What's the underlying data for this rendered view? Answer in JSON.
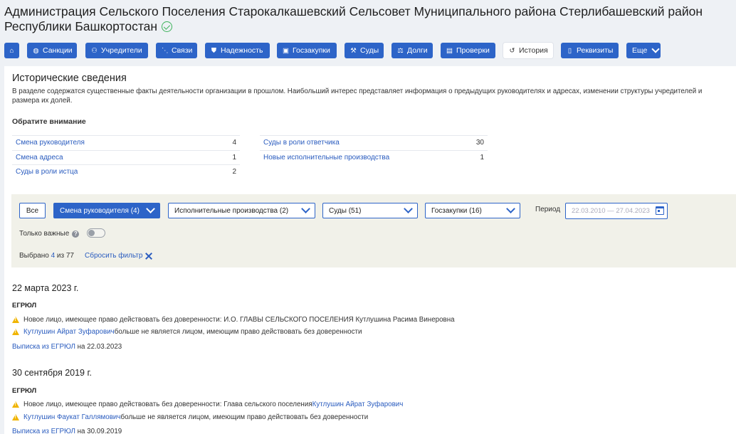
{
  "org": {
    "title": "Администрация Сельского Поселения Старокалкашевский Сельсовет Муниципального района Стерлибашевский район Республики Башкортостан"
  },
  "nav": {
    "items": [
      {
        "label": "",
        "icon": "home-icon"
      },
      {
        "label": "Санкции",
        "icon": "globe-icon"
      },
      {
        "label": "Учредители",
        "icon": "users-icon"
      },
      {
        "label": "Связи",
        "icon": "network-icon"
      },
      {
        "label": "Надежность",
        "icon": "shield-icon"
      },
      {
        "label": "Госзакупки",
        "icon": "tender-icon"
      },
      {
        "label": "Суды",
        "icon": "gavel-icon"
      },
      {
        "label": "Долги",
        "icon": "scales-icon"
      },
      {
        "label": "Проверки",
        "icon": "clipboard-icon"
      },
      {
        "label": "История",
        "icon": "history-icon",
        "active": true
      },
      {
        "label": "Реквизиты",
        "icon": "document-icon"
      },
      {
        "label": "Еще",
        "icon": "chevron-down-icon"
      }
    ]
  },
  "section": {
    "title": "Исторические сведения",
    "description": "В разделе содержатся существенные факты деятельности организации в прошлом. Наибольший интерес представляет информация о предыдущих руководителях и адресах, изменении структуры учредителей и размера их долей.",
    "attention_label": "Обратите внимание"
  },
  "stats": {
    "left": [
      {
        "label": "Смена руководителя",
        "value": "4"
      },
      {
        "label": "Смена адреса",
        "value": "1"
      },
      {
        "label": "Суды в роли истца",
        "value": "2"
      }
    ],
    "right": [
      {
        "label": "Суды в роли ответчика",
        "value": "30"
      },
      {
        "label": "Новые исполнительные производства",
        "value": "1"
      }
    ]
  },
  "filters": {
    "all_label": "Все",
    "selects": [
      {
        "label": "Смена руководителя (4)",
        "active": true
      },
      {
        "label": "Исполнительные производства (2)"
      },
      {
        "label": "Суды (51)"
      },
      {
        "label": "Госзакупки (16)"
      }
    ],
    "period_label": "Период",
    "period_placeholder": "22.03.2010 — 27.04.2023",
    "important_label": "Только важные",
    "help_symbol": "?",
    "selected_prefix": "Выбрано",
    "selected_count": "4",
    "selected_suffix": "из 77",
    "reset_label": "Сбросить фильтр"
  },
  "events": [
    {
      "date": "22 марта 2023 г.",
      "registry": "ЕГРЮЛ",
      "items": [
        {
          "text": "Новое лицо, имеющее право действовать без доверенности: И.О. ГЛАВЫ СЕЛЬСКОГО ПОСЕЛЕНИЯ Кутлушина Расима Винеровна",
          "link": ""
        },
        {
          "link": "Кутлушин Айрат Зуфарович",
          "text": " больше не является лицом, имеющим право действовать без доверенности"
        }
      ],
      "extract_link": "Выписка из ЕГРЮЛ",
      "extract_date": " на 22.03.2023"
    },
    {
      "date": "30 сентября 2019 г.",
      "registry": "ЕГРЮЛ",
      "items": [
        {
          "text": "Новое лицо, имеющее право действовать без доверенности: Глава сельского поселения ",
          "link_after": "Кутлушин Айрат Зуфарович"
        },
        {
          "link": "Кутлушин Фаукат Галлямович",
          "text": " больше не является лицом, имеющим право действовать без доверенности"
        }
      ],
      "extract_link": "Выписка из ЕГРЮЛ",
      "extract_date": " на 30.09.2019"
    }
  ]
}
